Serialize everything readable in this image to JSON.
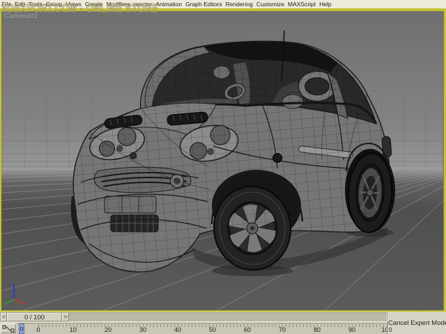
{
  "menu": {
    "items": [
      "File",
      "Edit",
      "Tools",
      "Group",
      "Views",
      "Create",
      "Modifiers",
      "reactor",
      "Animation",
      "Graph Editors",
      "Rendering",
      "Customize",
      "MAXScript",
      "Help"
    ]
  },
  "watermark": {
    "text": "3DEXPORT.COM - ONLINE STORE"
  },
  "viewport": {
    "camera_label": "Camera01",
    "content_description": "wireframe smart car 3d model on perspective grid"
  },
  "timeline": {
    "frame_display": "0 / 100",
    "prev_arrow": "<",
    "next_arrow": ">",
    "current_frame": "0",
    "ticks": [
      "0",
      "10",
      "20",
      "30",
      "40",
      "50",
      "60",
      "70",
      "80",
      "90",
      "100"
    ],
    "tick_start_x": 31,
    "tick_spacing_px": 50
  },
  "expert_mode": {
    "cancel_label": "Cancel Expert Mode"
  },
  "icons": {
    "mini_curve_editor": "curve-editor-icon",
    "prev_frame": "left-arrow-icon",
    "next_frame": "right-arrow-icon",
    "world_axis": "axis-tripod-icon"
  },
  "colors": {
    "accent": "#c6c231",
    "menu-bg": "#eeebdb",
    "panel-bg": "#d8d4c5",
    "frame-marker": "#8fa8d8",
    "axis-x": "#c23a2c",
    "axis-y": "#2f9e33",
    "axis-z": "#2f3fc2"
  }
}
